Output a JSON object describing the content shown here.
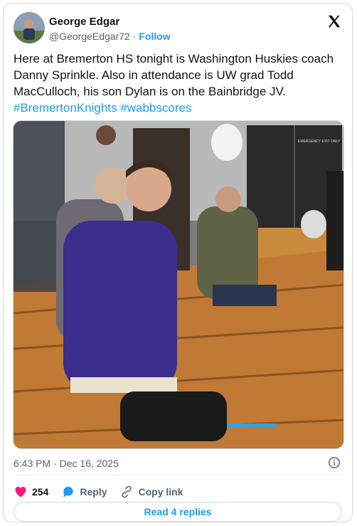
{
  "author": {
    "name": "George Edgar",
    "handle": "@GeorgeEdgar72",
    "separator": "·",
    "follow_label": "Follow"
  },
  "tweet": {
    "text": "Here at Bremerton HS tonight is Washington Huskies coach Danny Sprinkle. Also in attendance is UW grad Todd MacCulloch, his son Dylan is on the Bainbridge JV.",
    "hashtags": [
      "#BremertonKnights",
      "#wabbscores"
    ]
  },
  "photo": {
    "exit_sign": "EMERGENCY EXIT ONLY"
  },
  "meta": {
    "timestamp": "6:43 PM · Dec 16, 2025"
  },
  "actions": {
    "likes_count": "254",
    "reply_label": "Reply",
    "copy_link_label": "Copy link"
  },
  "read_replies_label": "Read 4 replies",
  "colors": {
    "accent": "#1d9bf0",
    "like": "#f91880",
    "text": "#0f1419",
    "muted": "#536471"
  },
  "icons": [
    "x-logo-icon",
    "info-icon",
    "heart-icon",
    "reply-icon",
    "link-icon"
  ]
}
